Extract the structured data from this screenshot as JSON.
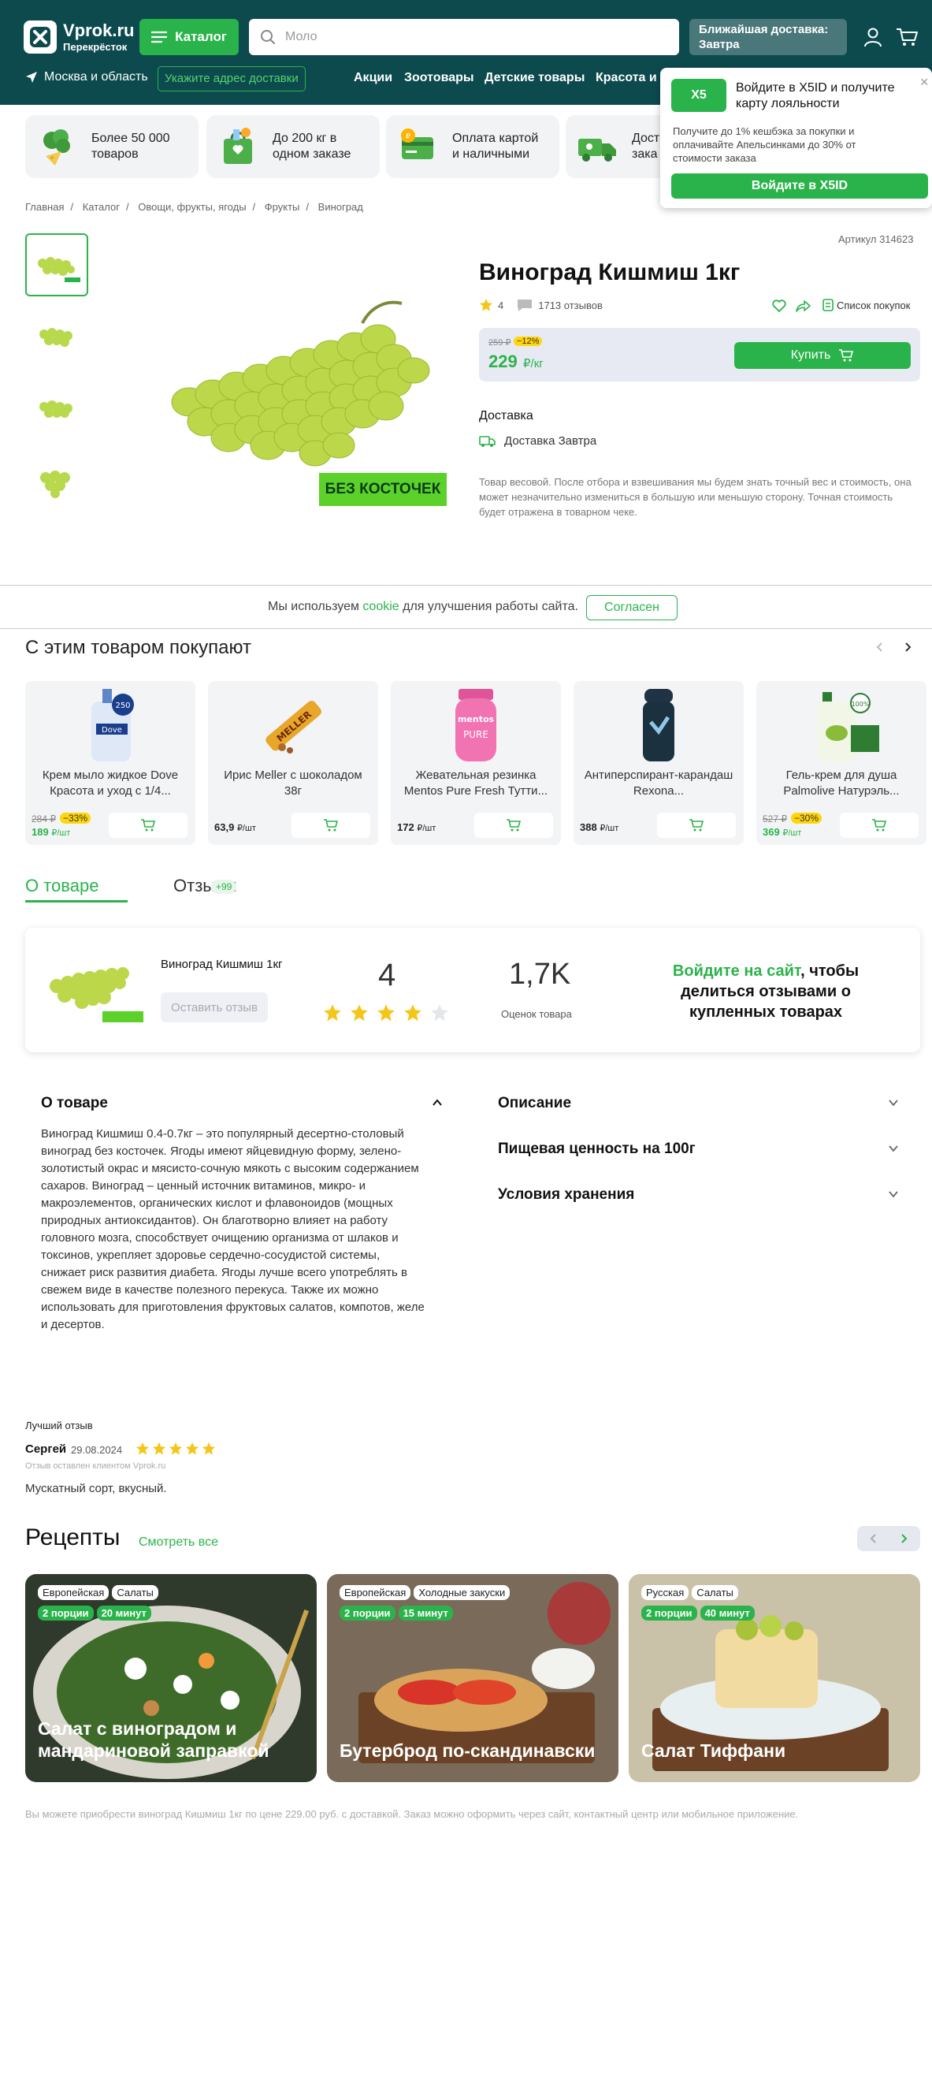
{
  "header": {
    "logo_title": "Vprok.ru",
    "logo_subtitle": "Перекрёсток",
    "catalog_label": "Каталог",
    "search_placeholder": "Моло",
    "delivery_line1": "Ближайшая доставка:",
    "delivery_line2": "Завтра",
    "region": "Москва и область",
    "address_button": "Укажите адрес доставки",
    "nav": [
      "Акции",
      "Зоотовары",
      "Детские товары",
      "Красота и"
    ]
  },
  "x5_popup": {
    "logo": "X5",
    "title": "Войдите в X5ID и получите карту лояльности",
    "text": "Получите до 1% кешбэка за покупки и оплачивайте Апельсинками до 30% от стоимости заказа",
    "button": "Войдите в X5ID"
  },
  "features": [
    {
      "icon": "broccoli-icon",
      "text": "Более 50 000 товаров"
    },
    {
      "icon": "grocery-bag-icon",
      "text": "До 200 кг в одном заказе"
    },
    {
      "icon": "card-coin-icon",
      "text": "Оплата картой и наличными"
    },
    {
      "icon": "delivery-truck-icon",
      "text": "Дост зака"
    }
  ],
  "breadcrumb": [
    "Главная",
    "Каталог",
    "Овощи, фрукты, ягоды",
    "Фрукты",
    "Виноград"
  ],
  "product": {
    "article": "Артикул 314623",
    "title": "Виноград Кишмиш 1кг",
    "rating": "4",
    "reviews": "1713 отзывов",
    "shopping_list": "Список покупок",
    "old_price": "259 ₽",
    "discount": "−12%",
    "price": "229",
    "price_unit": "₽/кг",
    "buy_label": "Купить",
    "seedless_badge": "БЕЗ КОСТОЧЕК",
    "delivery_heading": "Доставка",
    "delivery_value": "Доставка Завтра",
    "weight_note": "Товар весовой. После отбора и взвешивания мы будем знать точный вес и стоимость, она может незначительно измениться в большую или меньшую сторону. Точная стоимость будет отражена в товарном чеке."
  },
  "cookie": {
    "text_before": "Мы используем ",
    "link": "cookie",
    "text_after": " для улучшения работы сайта.",
    "button": "Согласен"
  },
  "related": {
    "title": "С этим товаром покупают",
    "items": [
      {
        "name": "Крем мыло жидкое Dove Красота и уход с 1/4...",
        "old_price": "284 ₽",
        "discount": "−33%",
        "price": "189",
        "unit": "₽/шт"
      },
      {
        "name": "Ирис Meller с шоколадом 38г",
        "old_price": "",
        "discount": "",
        "price": "63,9",
        "unit": "₽/шт"
      },
      {
        "name": "Жевательная резинка Mentos Pure Fresh Тутти...",
        "old_price": "",
        "discount": "",
        "price": "172",
        "unit": "₽/шт"
      },
      {
        "name": "Антиперспирант-карандаш Rexona...",
        "old_price": "",
        "discount": "",
        "price": "388",
        "unit": "₽/шт"
      },
      {
        "name": "Гель-крем для душа Palmolive Натурэль...",
        "old_price": "527 ₽",
        "discount": "−30%",
        "price": "369",
        "unit": "₽/шт"
      }
    ]
  },
  "tabs": {
    "about": "О товаре",
    "reviews": "Отзывы",
    "reviews_badge": "+99"
  },
  "review_summary": {
    "product_name": "Виноград Кишмиш 1кг",
    "leave_review": "Оставить отзыв",
    "rating": "4",
    "rating_value": 4,
    "rating_max": 5,
    "count": "1,7K",
    "count_label": "Оценок товара",
    "cta_link": "Войдите на сайт",
    "cta_rest": ", чтобы делиться отзывами о купленных товарах"
  },
  "about": {
    "heading": "О товаре",
    "text": "Виноград Кишмиш 0.4-0.7кг – это популярный десертно-столовый виноград без косточек. Ягоды имеют яйцевидную форму, зелено-золотистый окрас и мясисто-сочную мякоть с высоким содержанием сахаров. Виноград – ценный источник витаминов, микро- и макроэлементов, органических кислот и флавоноидов (мощных природных антиоксидантов). Он благотворно влияет на работу головного мозга, способствует очищению организма от шлаков и токсинов, укрепляет здоровье сердечно-сосудистой системы, снижает риск развития диабета. Ягоды лучше всего употреблять в свежем виде в качестве полезного перекуса. Также их можно использовать для приготовления фруктовых салатов, компотов, желе и десертов.",
    "right_sections": [
      "Описание",
      "Пищевая ценность на 100г",
      "Условия хранения"
    ]
  },
  "best_review": {
    "heading": "Лучший отзыв",
    "author": "Сергей",
    "date": "29.08.2024",
    "stars": 5,
    "source": "Отзыв оставлен клиентом Vprok.ru",
    "text": "Мускатный сорт, вкусный."
  },
  "recipes": {
    "title": "Рецепты",
    "see_all": "Смотреть все",
    "items": [
      {
        "tags": [
          "Европейская",
          "Салаты"
        ],
        "portions": "2 порции",
        "time": "20 минут",
        "name": "Салат с виноградом и мандариновой заправкой",
        "bg": "#3d4a3a"
      },
      {
        "tags": [
          "Европейская",
          "Холодные закуски"
        ],
        "portions": "2 порции",
        "time": "15 минут",
        "name": "Бутерброд по-скандинавски",
        "bg": "#6b4a36"
      },
      {
        "tags": [
          "Русская",
          "Салаты"
        ],
        "portions": "2 порции",
        "time": "40 минут",
        "name": "Салат Тиффани",
        "bg": "#8a7a5a"
      }
    ]
  },
  "footnote": "Вы можете приобрести виноград Кишмиш 1кг по цене 229.00 руб. с доставкой. Заказ можно оформить через сайт, контактный центр или мобильное приложение.",
  "colors": {
    "brand_dark": "#0d4a4e",
    "accent": "#2bb34b",
    "star": "#f5c518",
    "discount": "#ffd60a"
  }
}
